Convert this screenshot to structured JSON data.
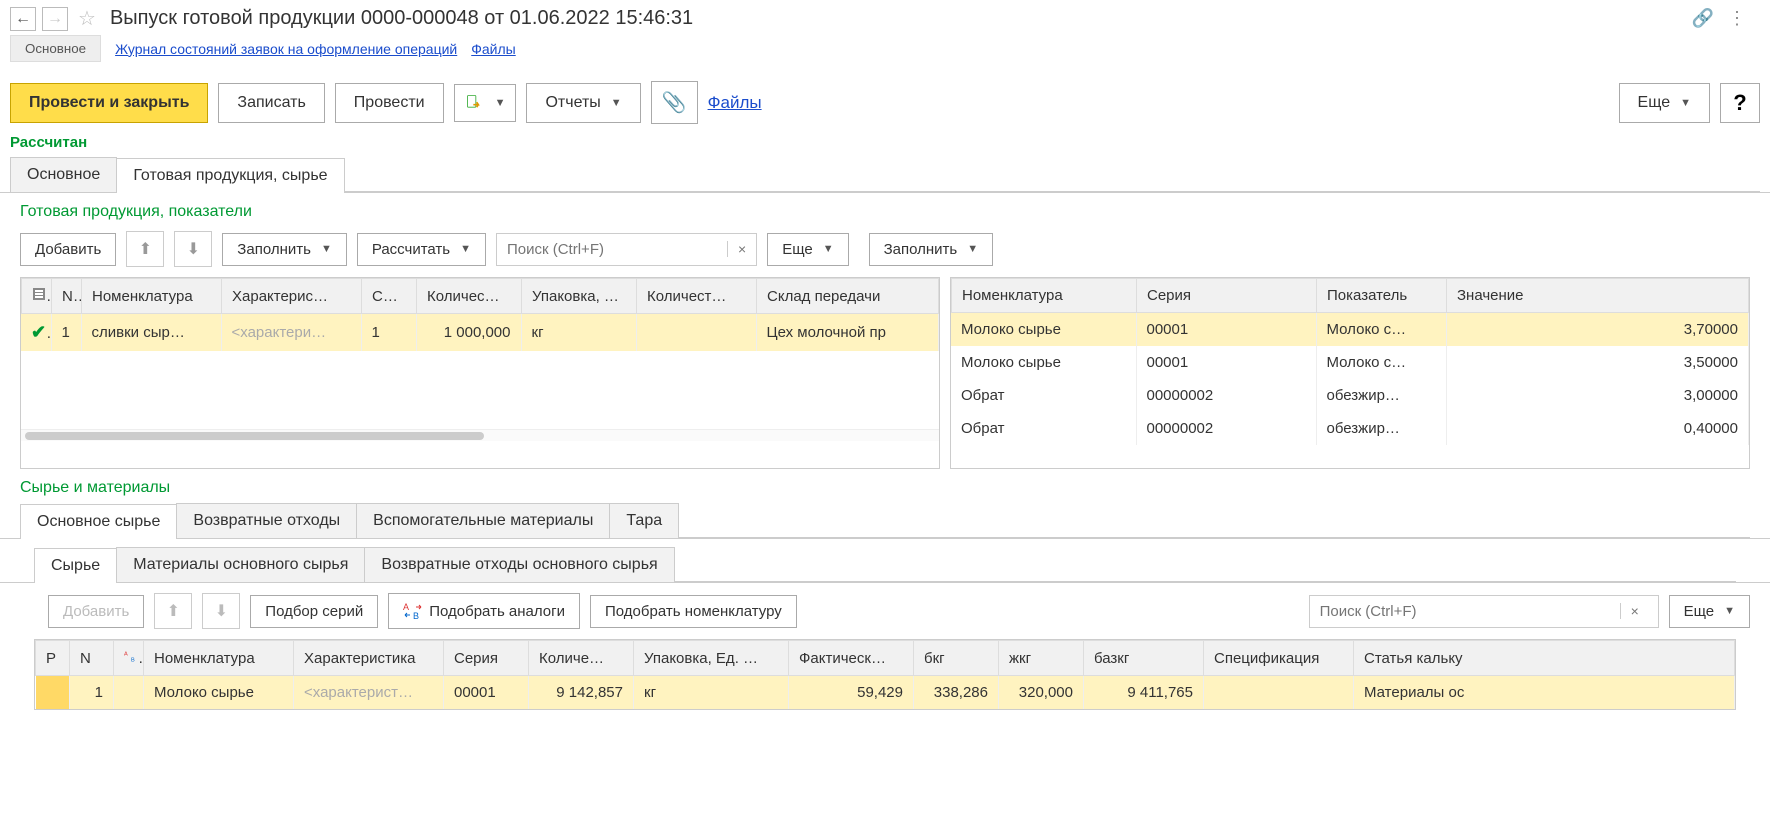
{
  "header": {
    "title": "Выпуск готовой продукции 0000-000048 от 01.06.2022 15:46:31"
  },
  "subnav": {
    "main_btn": "Основное",
    "link_journal": "Журнал состояний заявок на оформление операций",
    "link_files": "Файлы"
  },
  "toolbar": {
    "post_close": "Провести и закрыть",
    "save": "Записать",
    "post": "Провести",
    "reports": "Отчеты",
    "files_link": "Файлы",
    "more": "Еще"
  },
  "status": "Рассчитан",
  "tabs_main": {
    "tab1": "Основное",
    "tab2": "Готовая продукция, сырье"
  },
  "section1": {
    "title": "Готовая продукция, показатели",
    "add_btn": "Добавить",
    "fill_btn": "Заполнить",
    "calc_btn": "Рассчитать",
    "search_ph": "Поиск (Ctrl+F)",
    "more": "Еще",
    "fill_btn2": "Заполнить"
  },
  "grid1": {
    "cols": {
      "n": "N",
      "nom": "Номенклатура",
      "char": "Характерис…",
      "ser": "Се…",
      "qty": "Количес…",
      "pack": "Упаковка, …",
      "qty2": "Количест…",
      "wh": "Склад передачи"
    },
    "row": {
      "n": "1",
      "nom": "сливки сыр…",
      "char": "<характери…",
      "ser": "1",
      "qty": "1 000,000",
      "pack": "кг",
      "qty2": "",
      "wh": "Цех молочной пр"
    }
  },
  "grid2": {
    "cols": {
      "nom": "Номенклатура",
      "ser": "Серия",
      "ind": "Показатель",
      "val": "Значение"
    },
    "rows": [
      {
        "nom": "Молоко сырье",
        "ser": "00001",
        "ind": "Молоко с…",
        "val": "3,70000"
      },
      {
        "nom": "Молоко сырье",
        "ser": "00001",
        "ind": "Молоко с…",
        "val": "3,50000"
      },
      {
        "nom": "Обрат",
        "ser": "00000002",
        "ind": "обезжир…",
        "val": "3,00000"
      },
      {
        "nom": "Обрат",
        "ser": "00000002",
        "ind": "обезжир…",
        "val": "0,40000"
      }
    ]
  },
  "section2": {
    "title": "Сырье и материалы"
  },
  "tabs2": {
    "t1": "Основное сырье",
    "t2": "Возвратные отходы",
    "t3": "Вспомогательные материалы",
    "t4": "Тара"
  },
  "tabs3": {
    "t1": "Сырье",
    "t2": "Материалы основного сырья",
    "t3": "Возвратные отходы основного сырья"
  },
  "section3": {
    "add_btn": "Добавить",
    "pick_series": "Подбор серий",
    "pick_analogs": "Подобрать аналоги",
    "pick_nom": "Подобрать номенклатуру",
    "search_ph": "Поиск (Ctrl+F)",
    "more": "Еще"
  },
  "grid3": {
    "cols": {
      "p": "Р",
      "n": "N",
      "nom": "Номенклатура",
      "char": "Характеристика",
      "ser": "Серия",
      "qty": "Количе…",
      "pack": "Упаковка, Ед. …",
      "fact": "Фактическ…",
      "bkg": "бкг",
      "jkg": "жкг",
      "bazkg": "базкг",
      "spec": "Спецификация",
      "cost": "Статья кальку"
    },
    "row": {
      "n": "1",
      "nom": "Молоко сырье",
      "char": "<характерист…",
      "ser": "00001",
      "qty": "9 142,857",
      "pack": "кг",
      "fact": "59,429",
      "bkg": "338,286",
      "jkg": "320,000",
      "bazkg": "9 411,765",
      "spec": "",
      "cost": "Материалы ос"
    }
  }
}
